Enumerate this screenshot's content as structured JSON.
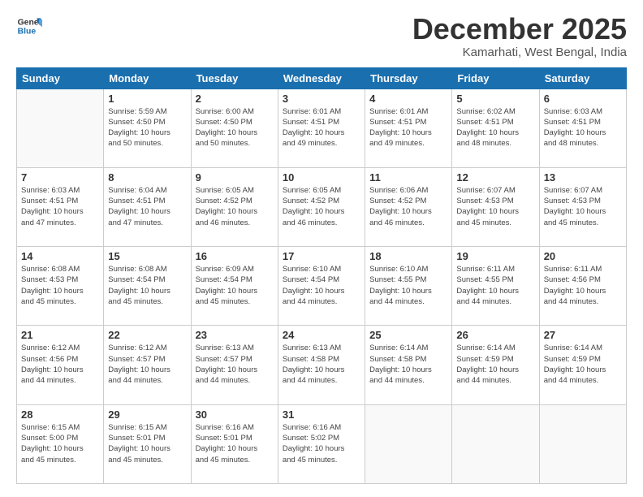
{
  "header": {
    "logo_line1": "General",
    "logo_line2": "Blue",
    "month": "December 2025",
    "location": "Kamarhati, West Bengal, India"
  },
  "weekdays": [
    "Sunday",
    "Monday",
    "Tuesday",
    "Wednesday",
    "Thursday",
    "Friday",
    "Saturday"
  ],
  "weeks": [
    [
      {
        "day": "",
        "info": ""
      },
      {
        "day": "1",
        "info": "Sunrise: 5:59 AM\nSunset: 4:50 PM\nDaylight: 10 hours\nand 50 minutes."
      },
      {
        "day": "2",
        "info": "Sunrise: 6:00 AM\nSunset: 4:50 PM\nDaylight: 10 hours\nand 50 minutes."
      },
      {
        "day": "3",
        "info": "Sunrise: 6:01 AM\nSunset: 4:51 PM\nDaylight: 10 hours\nand 49 minutes."
      },
      {
        "day": "4",
        "info": "Sunrise: 6:01 AM\nSunset: 4:51 PM\nDaylight: 10 hours\nand 49 minutes."
      },
      {
        "day": "5",
        "info": "Sunrise: 6:02 AM\nSunset: 4:51 PM\nDaylight: 10 hours\nand 48 minutes."
      },
      {
        "day": "6",
        "info": "Sunrise: 6:03 AM\nSunset: 4:51 PM\nDaylight: 10 hours\nand 48 minutes."
      }
    ],
    [
      {
        "day": "7",
        "info": "Sunrise: 6:03 AM\nSunset: 4:51 PM\nDaylight: 10 hours\nand 47 minutes."
      },
      {
        "day": "8",
        "info": "Sunrise: 6:04 AM\nSunset: 4:51 PM\nDaylight: 10 hours\nand 47 minutes."
      },
      {
        "day": "9",
        "info": "Sunrise: 6:05 AM\nSunset: 4:52 PM\nDaylight: 10 hours\nand 46 minutes."
      },
      {
        "day": "10",
        "info": "Sunrise: 6:05 AM\nSunset: 4:52 PM\nDaylight: 10 hours\nand 46 minutes."
      },
      {
        "day": "11",
        "info": "Sunrise: 6:06 AM\nSunset: 4:52 PM\nDaylight: 10 hours\nand 46 minutes."
      },
      {
        "day": "12",
        "info": "Sunrise: 6:07 AM\nSunset: 4:53 PM\nDaylight: 10 hours\nand 45 minutes."
      },
      {
        "day": "13",
        "info": "Sunrise: 6:07 AM\nSunset: 4:53 PM\nDaylight: 10 hours\nand 45 minutes."
      }
    ],
    [
      {
        "day": "14",
        "info": "Sunrise: 6:08 AM\nSunset: 4:53 PM\nDaylight: 10 hours\nand 45 minutes."
      },
      {
        "day": "15",
        "info": "Sunrise: 6:08 AM\nSunset: 4:54 PM\nDaylight: 10 hours\nand 45 minutes."
      },
      {
        "day": "16",
        "info": "Sunrise: 6:09 AM\nSunset: 4:54 PM\nDaylight: 10 hours\nand 45 minutes."
      },
      {
        "day": "17",
        "info": "Sunrise: 6:10 AM\nSunset: 4:54 PM\nDaylight: 10 hours\nand 44 minutes."
      },
      {
        "day": "18",
        "info": "Sunrise: 6:10 AM\nSunset: 4:55 PM\nDaylight: 10 hours\nand 44 minutes."
      },
      {
        "day": "19",
        "info": "Sunrise: 6:11 AM\nSunset: 4:55 PM\nDaylight: 10 hours\nand 44 minutes."
      },
      {
        "day": "20",
        "info": "Sunrise: 6:11 AM\nSunset: 4:56 PM\nDaylight: 10 hours\nand 44 minutes."
      }
    ],
    [
      {
        "day": "21",
        "info": "Sunrise: 6:12 AM\nSunset: 4:56 PM\nDaylight: 10 hours\nand 44 minutes."
      },
      {
        "day": "22",
        "info": "Sunrise: 6:12 AM\nSunset: 4:57 PM\nDaylight: 10 hours\nand 44 minutes."
      },
      {
        "day": "23",
        "info": "Sunrise: 6:13 AM\nSunset: 4:57 PM\nDaylight: 10 hours\nand 44 minutes."
      },
      {
        "day": "24",
        "info": "Sunrise: 6:13 AM\nSunset: 4:58 PM\nDaylight: 10 hours\nand 44 minutes."
      },
      {
        "day": "25",
        "info": "Sunrise: 6:14 AM\nSunset: 4:58 PM\nDaylight: 10 hours\nand 44 minutes."
      },
      {
        "day": "26",
        "info": "Sunrise: 6:14 AM\nSunset: 4:59 PM\nDaylight: 10 hours\nand 44 minutes."
      },
      {
        "day": "27",
        "info": "Sunrise: 6:14 AM\nSunset: 4:59 PM\nDaylight: 10 hours\nand 44 minutes."
      }
    ],
    [
      {
        "day": "28",
        "info": "Sunrise: 6:15 AM\nSunset: 5:00 PM\nDaylight: 10 hours\nand 45 minutes."
      },
      {
        "day": "29",
        "info": "Sunrise: 6:15 AM\nSunset: 5:01 PM\nDaylight: 10 hours\nand 45 minutes."
      },
      {
        "day": "30",
        "info": "Sunrise: 6:16 AM\nSunset: 5:01 PM\nDaylight: 10 hours\nand 45 minutes."
      },
      {
        "day": "31",
        "info": "Sunrise: 6:16 AM\nSunset: 5:02 PM\nDaylight: 10 hours\nand 45 minutes."
      },
      {
        "day": "",
        "info": ""
      },
      {
        "day": "",
        "info": ""
      },
      {
        "day": "",
        "info": ""
      }
    ]
  ]
}
